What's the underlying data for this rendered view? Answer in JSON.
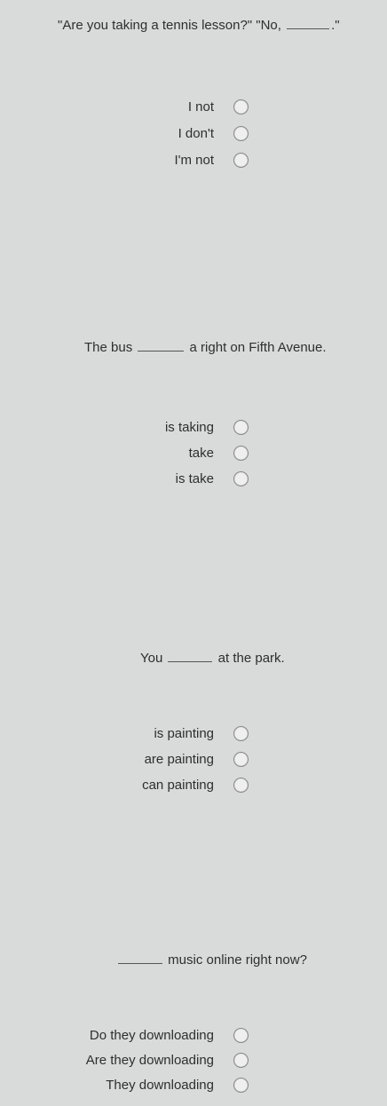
{
  "questions": [
    {
      "before": "\"Are you taking a tennis lesson?\" \"No,",
      "after": ".\"",
      "options": [
        "I not",
        "I don't",
        "I'm not"
      ]
    },
    {
      "before": "The bus",
      "after": "a right on Fifth Avenue.",
      "options": [
        "is taking",
        "take",
        "is take"
      ]
    },
    {
      "before": "You",
      "after": "at the park.",
      "options": [
        "is painting",
        "are painting",
        "can painting"
      ]
    },
    {
      "before": "",
      "after": "music online right now?",
      "options": [
        "Do they downloading",
        "Are they downloading",
        "They downloading"
      ]
    }
  ]
}
